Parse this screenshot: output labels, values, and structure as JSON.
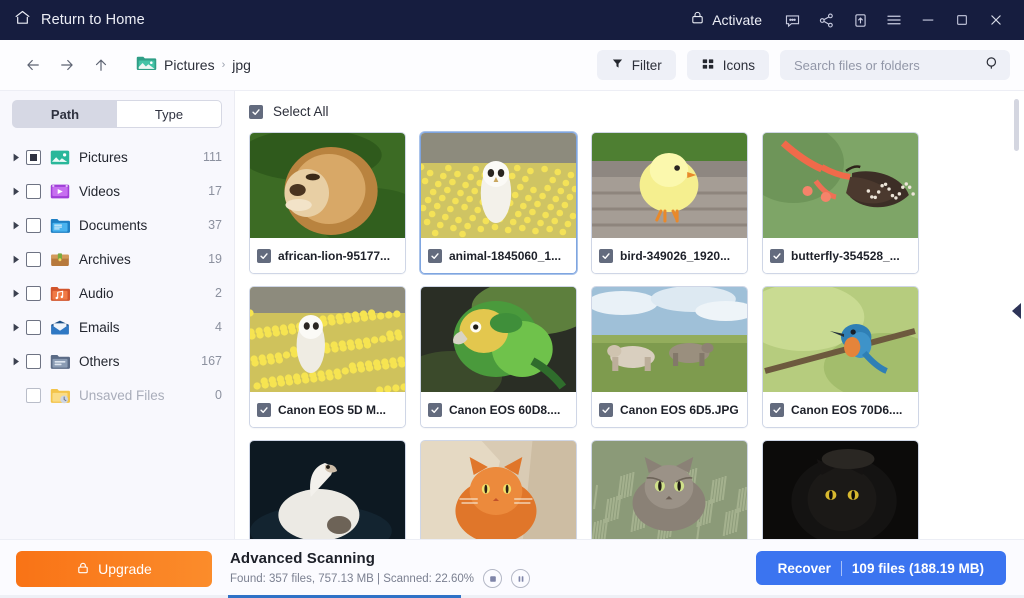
{
  "titlebar": {
    "home_label": "Return to Home",
    "home_icon": "home-icon",
    "activate_label": "Activate",
    "activate_icon": "lock-icon",
    "icons": [
      "feedback-icon",
      "share-icon",
      "upload-icon",
      "menu-icon",
      "minimize-icon",
      "maximize-icon",
      "close-icon"
    ],
    "bg": "#161d3f"
  },
  "navbar": {
    "back_icon": "arrow-left-icon",
    "forward_icon": "arrow-right-icon",
    "up_icon": "arrow-up-icon",
    "breadcrumb": {
      "folder_icon": "pictures-folder-icon",
      "root": "Pictures",
      "separator": "›",
      "current": "jpg"
    },
    "filter_label": "Filter",
    "filter_icon": "funnel-icon",
    "view_label": "Icons",
    "view_icon": "grid-icon",
    "search_placeholder": "Search files or folders",
    "search_value": "",
    "search_icon": "search-icon"
  },
  "sidebar": {
    "tabs": {
      "path": "Path",
      "type": "Type",
      "active": "Path"
    },
    "items": [
      {
        "label": "Pictures",
        "count": "111",
        "icon": "pictures-icon",
        "state": "partial",
        "expandable": true,
        "muted": false
      },
      {
        "label": "Videos",
        "count": "17",
        "icon": "videos-icon",
        "state": "off",
        "expandable": true,
        "muted": false
      },
      {
        "label": "Documents",
        "count": "37",
        "icon": "documents-icon",
        "state": "off",
        "expandable": true,
        "muted": false
      },
      {
        "label": "Archives",
        "count": "19",
        "icon": "archives-icon",
        "state": "off",
        "expandable": true,
        "muted": false
      },
      {
        "label": "Audio",
        "count": "2",
        "icon": "audio-icon",
        "state": "off",
        "expandable": true,
        "muted": false
      },
      {
        "label": "Emails",
        "count": "4",
        "icon": "emails-icon",
        "state": "off",
        "expandable": true,
        "muted": false
      },
      {
        "label": "Others",
        "count": "167",
        "icon": "others-icon",
        "state": "off",
        "expandable": true,
        "muted": false
      },
      {
        "label": "Unsaved Files",
        "count": "0",
        "icon": "unsaved-icon",
        "state": "off",
        "expandable": false,
        "muted": true
      }
    ]
  },
  "content": {
    "select_all_label": "Select All",
    "select_all_checked": true,
    "files": [
      {
        "name": "african-lion-95177...",
        "checked": true,
        "selected": false,
        "thumb": "lion"
      },
      {
        "name": "animal-1845060_1...",
        "checked": true,
        "selected": true,
        "thumb": "owl"
      },
      {
        "name": "bird-349026_1920...",
        "checked": true,
        "selected": false,
        "thumb": "chick"
      },
      {
        "name": "butterfly-354528_...",
        "checked": true,
        "selected": false,
        "thumb": "butterfly"
      },
      {
        "name": "Canon EOS 5D M...",
        "checked": true,
        "selected": false,
        "thumb": "owl2"
      },
      {
        "name": "Canon EOS 60D8....",
        "checked": true,
        "selected": false,
        "thumb": "parrot"
      },
      {
        "name": "Canon EOS 6D5.JPG",
        "checked": true,
        "selected": false,
        "thumb": "cows"
      },
      {
        "name": "Canon EOS 70D6....",
        "checked": true,
        "selected": false,
        "thumb": "kingfisher"
      },
      {
        "name": "",
        "checked": false,
        "selected": false,
        "thumb": "swan"
      },
      {
        "name": "",
        "checked": false,
        "selected": false,
        "thumb": "gingercat"
      },
      {
        "name": "",
        "checked": false,
        "selected": false,
        "thumb": "tabbycat"
      },
      {
        "name": "",
        "checked": false,
        "selected": false,
        "thumb": "blackcat"
      }
    ],
    "collapse_arrow_icon": "chevron-left-icon"
  },
  "footer": {
    "upgrade_label": "Upgrade",
    "upgrade_icon": "lock-icon",
    "scan_title": "Advanced Scanning",
    "scan_meta": "Found: 357 files, 757.13 MB  |  Scanned: 22.60%",
    "stop_icon": "stop-icon",
    "pause_icon": "pause-icon",
    "recover_label": "Recover",
    "recover_count": "109 files (188.19 MB)",
    "progress_percent": 22.6,
    "accent_blue": "#3b74f0",
    "accent_orange": "#f97316"
  }
}
